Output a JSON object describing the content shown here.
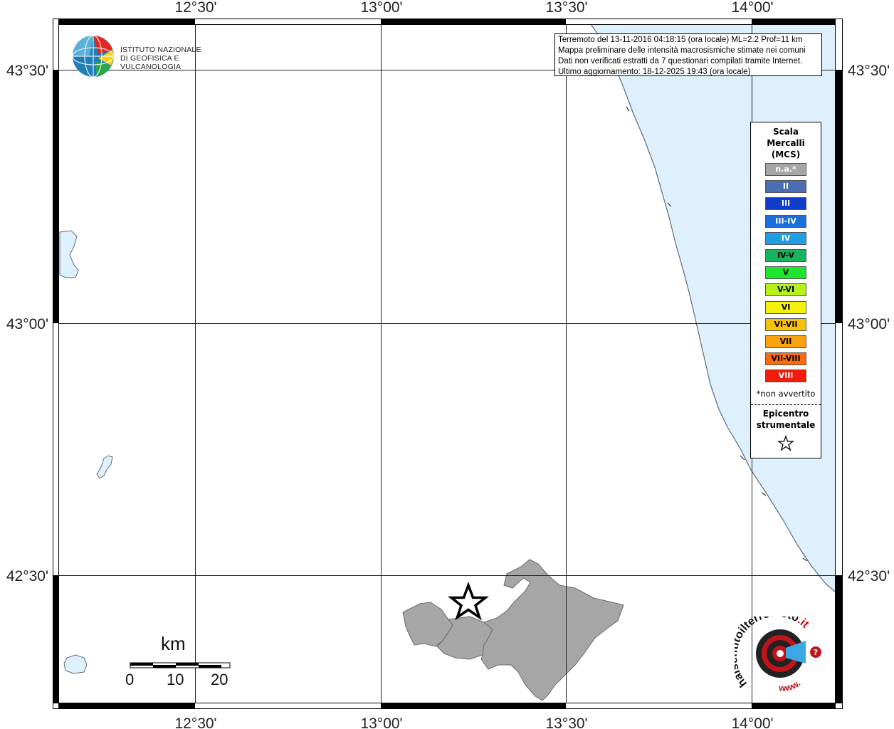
{
  "map": {
    "lon_labels": [
      "12°30'",
      "13°00'",
      "13°30'",
      "14°00'"
    ],
    "lat_labels": [
      "43°30'",
      "43°00'",
      "42°30'"
    ],
    "sea_color": "#dff0fd",
    "land_color": "#ffffff",
    "municipality_color": "#a6a6a6",
    "epicenter_marker": "star-icon"
  },
  "header": {
    "logo": {
      "line1": "ISTITUTO NAZIONALE",
      "line2": "DI GEOFISICA E VULCANOLOGIA"
    },
    "info": {
      "line1": "Terremoto del 13-11-2016 04:18:15 (ora locale) ML=2.2 Prof=11 km",
      "line2": "Mappa preliminare delle intensità macrosismiche stimate nei comuni",
      "line3": "Dati non verificati estratti da 7 questionari compilati tramite Internet.",
      "line4": "Ultimo aggiornamento: 18-12-2025 19:43 (ora locale)"
    }
  },
  "legend": {
    "title_1": "Scala",
    "title_2": "Mercalli",
    "title_3": "(MCS)",
    "levels": [
      {
        "label": "n.a.*",
        "color": "#a6a6a6",
        "text_color": "#ffffff"
      },
      {
        "label": "II",
        "color": "#4a6db3",
        "text_color": "#ffffff"
      },
      {
        "label": "III",
        "color": "#0f3cc8",
        "text_color": "#ffffff"
      },
      {
        "label": "III-IV",
        "color": "#1a6fdc",
        "text_color": "#ffffff"
      },
      {
        "label": "IV",
        "color": "#1e9fe4",
        "text_color": "#ffffff"
      },
      {
        "label": "IV-V",
        "color": "#17b35f",
        "text_color": "#000000"
      },
      {
        "label": "V",
        "color": "#1ee62e",
        "text_color": "#000000"
      },
      {
        "label": "V-VI",
        "color": "#b6f21a",
        "text_color": "#000000"
      },
      {
        "label": "VI",
        "color": "#f5f10f",
        "text_color": "#000000"
      },
      {
        "label": "VI-VII",
        "color": "#f8c20c",
        "text_color": "#000000"
      },
      {
        "label": "VII",
        "color": "#fba30c",
        "text_color": "#000000"
      },
      {
        "label": "VII-VIII",
        "color": "#fb6b0c",
        "text_color": "#000000"
      },
      {
        "label": "VIII",
        "color": "#f21b0c",
        "text_color": "#ffffff"
      }
    ],
    "note": "*non avvertito",
    "epicenter_1": "Epicentro",
    "epicenter_2": "strumentale"
  },
  "scale": {
    "unit": "km",
    "ticks": [
      "0",
      "10",
      "20"
    ]
  },
  "badge": {
    "text_1": "haisentitoilterremoto",
    "text_2": ".it",
    "text_3": "www."
  }
}
